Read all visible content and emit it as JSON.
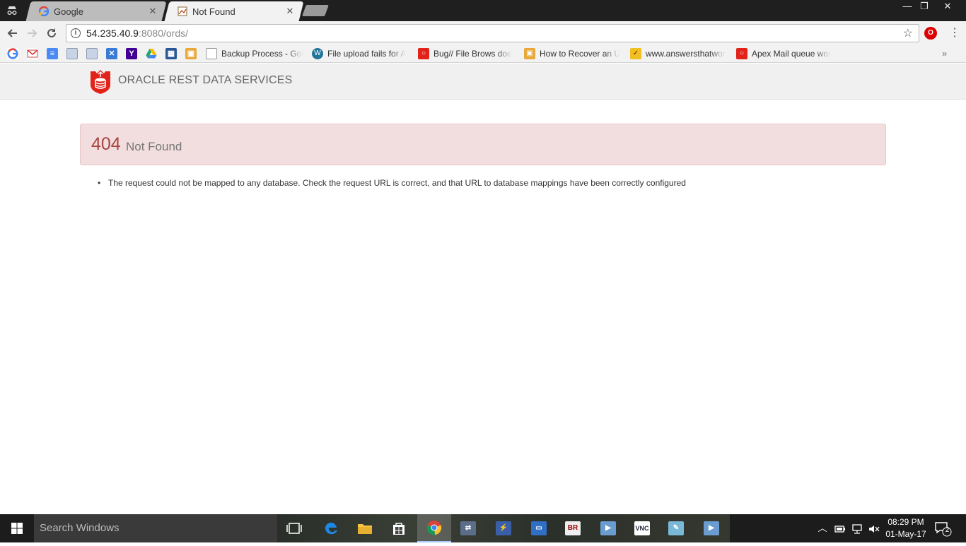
{
  "browser": {
    "tabs": [
      {
        "title": "Google",
        "favicon": "google-g-icon",
        "active": false
      },
      {
        "title": "Not Found",
        "favicon": "page-icon",
        "active": true
      }
    ],
    "address": {
      "host": "54.235.40.9",
      "rest": ":8080/ords/"
    },
    "bookmarks": [
      {
        "label": "Backup Process - Goo",
        "icon": "doc-icon"
      },
      {
        "label": "File upload fails for A",
        "icon": "wordpress-icon"
      },
      {
        "label": "Bug// File Brows doe",
        "icon": "oracle-icon"
      },
      {
        "label": "How to Recover an U",
        "icon": "box-icon"
      },
      {
        "label": "www.answersthatwor",
        "icon": "answers-icon"
      },
      {
        "label": "Apex Mail queue wor",
        "icon": "oracle-icon"
      }
    ]
  },
  "page": {
    "header_title": "ORACLE REST DATA SERVICES",
    "error_code": "404",
    "error_text": "Not Found",
    "messages": [
      "The request could not be mapped to any database. Check the request URL is correct, and that URL to database mappings have been correctly configured"
    ]
  },
  "taskbar": {
    "search_placeholder": "Search Windows",
    "time": "08:29 PM",
    "date": "01-May-17",
    "notification_count": "2"
  },
  "colors": {
    "alert_bg": "#f2dede",
    "alert_code": "#a94442",
    "oracle_red": "#e2231a"
  }
}
